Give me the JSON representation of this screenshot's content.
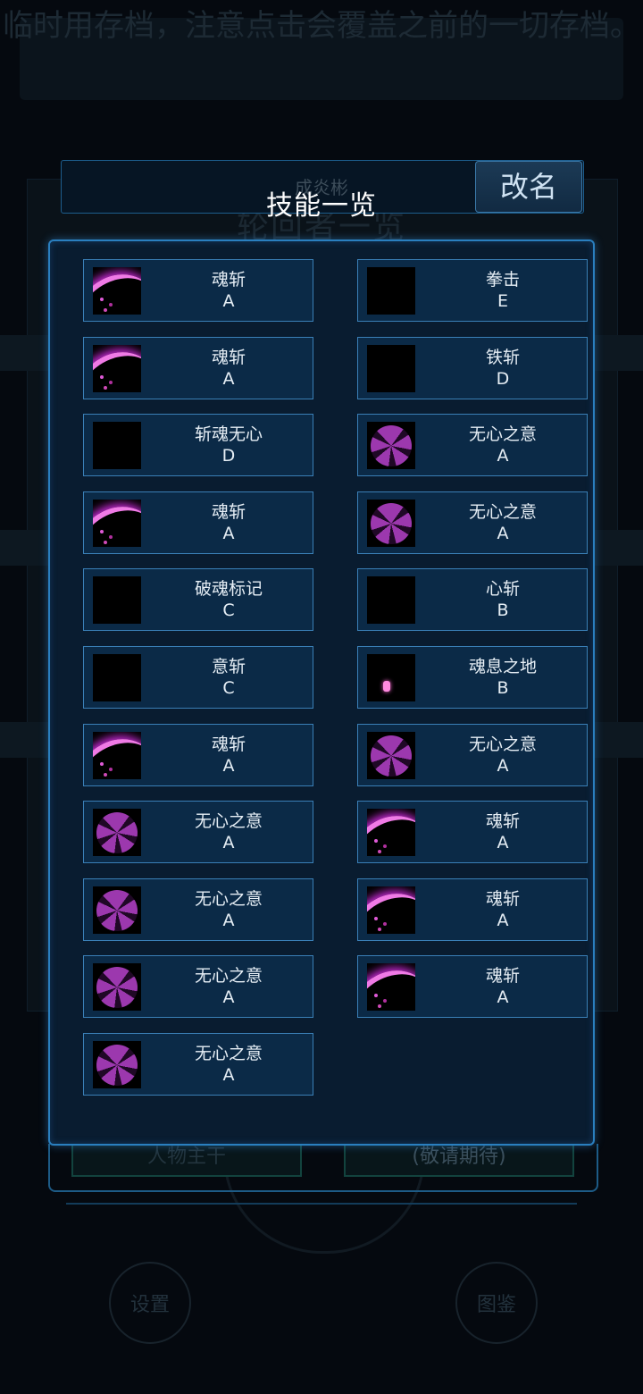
{
  "background": {
    "notice": "临时用存档，注意点击会覆盖之前的一切存档。",
    "player_name": "成炎彬",
    "underlying_title": "轮回者一览",
    "left_button": "人物主干",
    "right_button": "(敬请期待)",
    "settings": "设置",
    "codex": "图鉴"
  },
  "header": {
    "title": "技能一览",
    "rename_label": "改名"
  },
  "skills": [
    {
      "name": "魂斩",
      "grade": "A",
      "icon": "pink-slash-icon"
    },
    {
      "name": "拳击",
      "grade": "E",
      "icon": "spiral-icon"
    },
    {
      "name": "魂斩",
      "grade": "A",
      "icon": "pink-slash-icon"
    },
    {
      "name": "铁斩",
      "grade": "D",
      "icon": "ice-slash-icon"
    },
    {
      "name": "斩魂无心",
      "grade": "D",
      "icon": "purple-starburst-icon"
    },
    {
      "name": "无心之意",
      "grade": "A",
      "icon": "purple-flower-icon"
    },
    {
      "name": "魂斩",
      "grade": "A",
      "icon": "pink-slash-icon"
    },
    {
      "name": "无心之意",
      "grade": "A",
      "icon": "purple-flower-icon"
    },
    {
      "name": "破魂标记",
      "grade": "C",
      "icon": "vortex-icon"
    },
    {
      "name": "心斩",
      "grade": "B",
      "icon": "fire-slash-icon"
    },
    {
      "name": "意斩",
      "grade": "C",
      "icon": "green-blade-icon"
    },
    {
      "name": "魂息之地",
      "grade": "B",
      "icon": "portal-icon"
    },
    {
      "name": "魂斩",
      "grade": "A",
      "icon": "pink-slash-icon"
    },
    {
      "name": "无心之意",
      "grade": "A",
      "icon": "purple-flower-icon"
    },
    {
      "name": "无心之意",
      "grade": "A",
      "icon": "purple-flower-icon"
    },
    {
      "name": "魂斩",
      "grade": "A",
      "icon": "pink-slash-icon"
    },
    {
      "name": "无心之意",
      "grade": "A",
      "icon": "purple-flower-icon"
    },
    {
      "name": "魂斩",
      "grade": "A",
      "icon": "pink-slash-icon"
    },
    {
      "name": "无心之意",
      "grade": "A",
      "icon": "purple-flower-icon"
    },
    {
      "name": "魂斩",
      "grade": "A",
      "icon": "pink-slash-icon"
    },
    {
      "name": "无心之意",
      "grade": "A",
      "icon": "purple-flower-icon"
    }
  ]
}
